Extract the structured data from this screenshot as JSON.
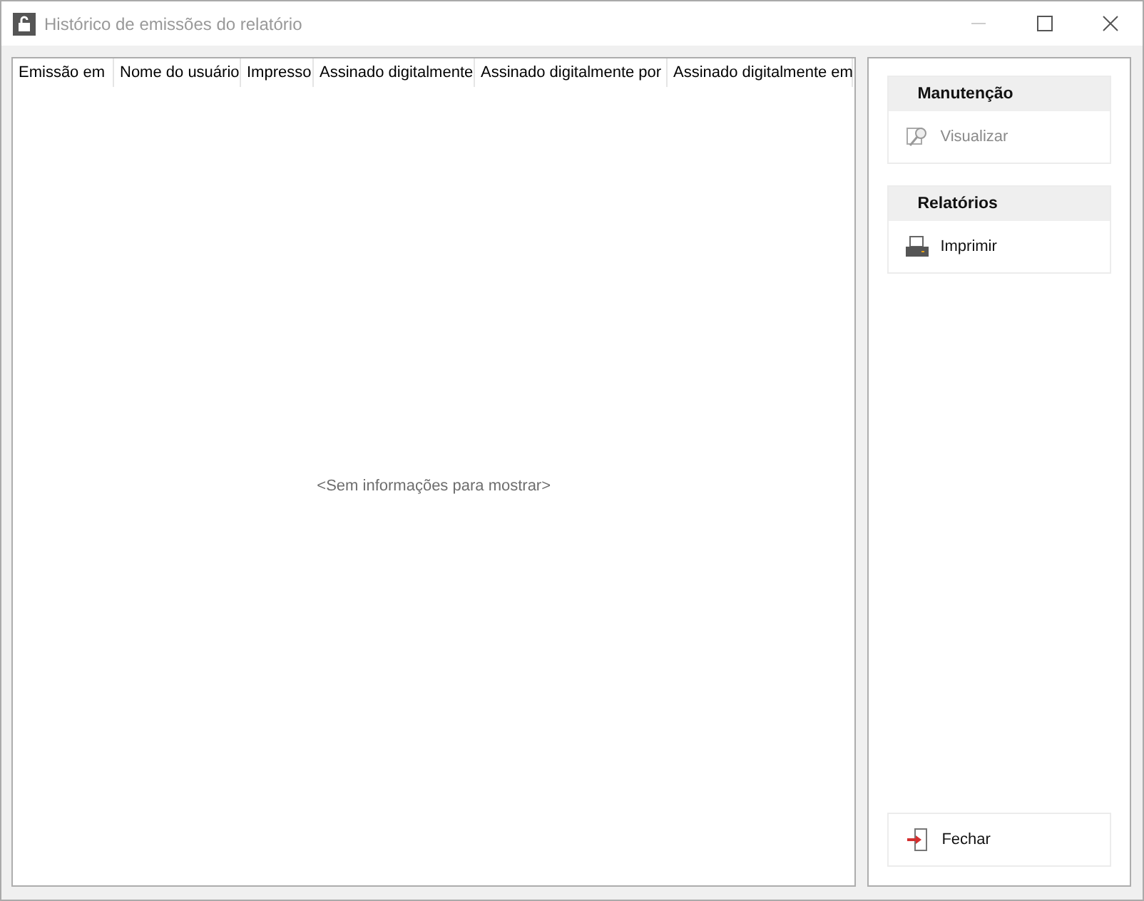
{
  "window": {
    "title": "Histórico de emissões do relatório",
    "controls": [
      {
        "kind": "minimize",
        "disabled": true
      },
      {
        "kind": "maximize",
        "disabled": false
      },
      {
        "kind": "close",
        "disabled": false
      }
    ]
  },
  "table": {
    "columns": [
      "Emissão em",
      "Nome do usuário",
      "Impresso",
      "Assinado digitalmente",
      "Assinado digitalmente por",
      "Assinado digitalmente em"
    ],
    "empty_text": "<Sem informações para mostrar>"
  },
  "sidebar": {
    "groups": [
      {
        "title": "Manutenção",
        "items": [
          {
            "label": "Visualizar",
            "kind": "view",
            "disabled": true
          }
        ]
      },
      {
        "title": "Relatórios",
        "items": [
          {
            "label": "Imprimir",
            "kind": "print",
            "disabled": false
          }
        ]
      }
    ],
    "footer_button": {
      "label": "Fechar",
      "kind": "exit",
      "disabled": false
    }
  }
}
